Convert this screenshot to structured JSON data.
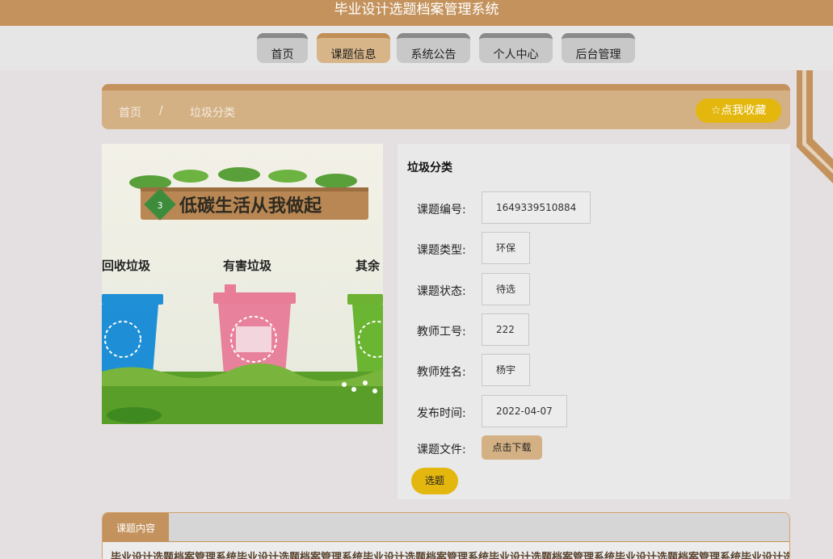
{
  "app": {
    "title": "毕业设计选题档案管理系统"
  },
  "nav": {
    "items": [
      "首页",
      "课题信息",
      "系统公告",
      "个人中心",
      "后台管理"
    ],
    "active": "课题信息"
  },
  "breadcrumb": {
    "home": "首页",
    "sep": "/",
    "current": "垃圾分类"
  },
  "favorite_button": "☆点我收藏",
  "image": {
    "banner": "低碳生活从我做起",
    "badge": "3",
    "bins": [
      "回收垃圾",
      "有害垃圾",
      "其余"
    ]
  },
  "detail": {
    "title": "垃圾分类",
    "fields": [
      {
        "label": "课题编号:",
        "value": "1649339510884"
      },
      {
        "label": "课题类型:",
        "value": "环保"
      },
      {
        "label": "课题状态:",
        "value": "待选"
      },
      {
        "label": "教师工号:",
        "value": "222"
      },
      {
        "label": "教师姓名:",
        "value": "杨宇"
      },
      {
        "label": "发布时间:",
        "value": "2022-04-07"
      }
    ],
    "file_label": "课题文件:",
    "download_button": "点击下载",
    "select_button": "选题"
  },
  "content": {
    "tab": "课题内容",
    "text": "毕业设计选题档案管理系统毕业设计选题档案管理系统毕业设计选题档案管理系统毕业设计选题档案管理系统毕业设计选题档案管理系统毕业设计选题档案"
  },
  "colors": {
    "brand": "#c4935d",
    "accent": "#e3b70d",
    "light": "#d4b184"
  }
}
